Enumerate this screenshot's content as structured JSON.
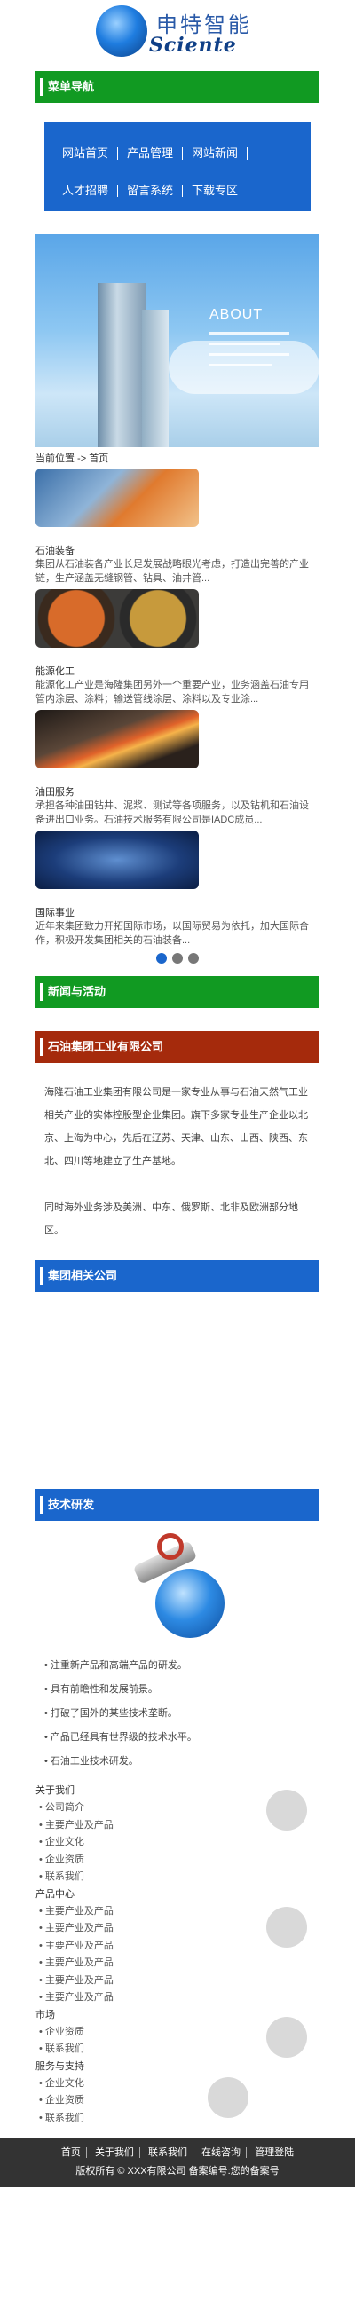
{
  "header": {
    "logo_zh": "申特智能",
    "logo_en": "Sciente"
  },
  "menu": {
    "title": "菜单导航",
    "rows": [
      [
        "网站首页",
        "产品管理",
        "网站新闻"
      ],
      [
        "人才招聘",
        "留言系统",
        "下载专区"
      ]
    ]
  },
  "banner": {
    "headline": "ABOUT"
  },
  "breadcrumb": "当前位置 -> 首页",
  "news_items": [
    {
      "title": "石油装备",
      "desc": "集团从石油装备产业长足发展战略眼光考虑，打造出完善的产业链，生产涵盖无缝钢管、钻具、油井管..."
    },
    {
      "title": "能源化工",
      "desc": "能源化工产业是海隆集团另外一个重要产业，业务涵盖石油专用管内涂层、涂料；输送管线涂层、涂料以及专业涂..."
    },
    {
      "title": "油田服务",
      "desc": "承担各种油田钻井、泥浆、测试等各项服务，以及钻机和石油设备进出口业务。石油技术服务有限公司是IADC成员..."
    },
    {
      "title": "国际事业",
      "desc": "近年来集团致力开拓国际市场，以国际贸易为依托，加大国际合作，积极开发集团相关的石油装备..."
    }
  ],
  "slider": {
    "count": 3,
    "active": 0
  },
  "sections": {
    "news": "新闻与活动",
    "company": "石油集团工业有限公司",
    "group": "集团相关公司",
    "tech": "技术研发"
  },
  "company_text": "海隆石油工业集团有限公司是一家专业从事与石油天然气工业相关产业的实体控股型企业集团。旗下多家专业生产企业以北京、上海为中心，先后在辽苏、天津、山东、山西、陕西、东北、四川等地建立了生产基地。",
  "company_text2": "同时海外业务涉及美洲、中东、俄罗斯、北非及欧洲部分地区。",
  "tech_list": [
    "注重新产品和高端产品的研发。",
    "具有前瞻性和发展前景。",
    "打破了国外的某些技术垄断。",
    "产品已经具有世界级的技术水平。",
    "石油工业技术研发。"
  ],
  "footer_groups": [
    {
      "head": "关于我们",
      "items": [
        "公司简介",
        "主要产业及产品",
        "企业文化",
        "企业资质",
        "联系我们"
      ]
    },
    {
      "head": "产品中心",
      "items": [
        "主要产业及产品",
        "主要产业及产品",
        "主要产业及产品",
        "主要产业及产品",
        "主要产业及产品",
        "主要产业及产品"
      ]
    },
    {
      "head": "市场",
      "items": [
        "企业资质",
        "联系我们"
      ]
    },
    {
      "head": "服务与支持",
      "items": [
        "企业文化",
        "企业资质",
        "联系我们"
      ]
    }
  ],
  "bottom": {
    "links": [
      "首页",
      "关于我们",
      "联系我们",
      "在线咨询",
      "管理登陆"
    ],
    "copyright": "版权所有 © XXX有限公司  备案编号:您的备案号"
  },
  "colors": {
    "green": "#119a22",
    "red": "#a52a0c",
    "blue": "#1a66cc",
    "footer": "#333333"
  }
}
